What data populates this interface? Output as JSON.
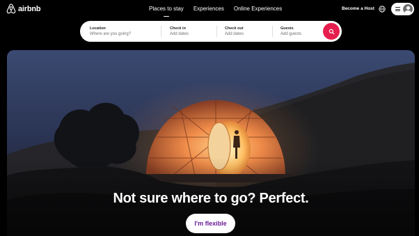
{
  "header": {
    "logo_text": "airbnb",
    "nav": [
      {
        "label": "Places to stay",
        "active": true
      },
      {
        "label": "Experiences",
        "active": false
      },
      {
        "label": "Online Experiences",
        "active": false
      }
    ],
    "become_host": "Become a Host",
    "icons": {
      "logo": "airbnb-logo-icon",
      "globe": "globe-icon",
      "menu": "hamburger-menu-icon",
      "avatar": "user-avatar-icon"
    }
  },
  "search": {
    "location": {
      "label": "Location",
      "placeholder": "Where are you going?"
    },
    "check_in": {
      "label": "Check in",
      "placeholder": "Add dates"
    },
    "check_out": {
      "label": "Check out",
      "placeholder": "Add dates"
    },
    "guests": {
      "label": "Guests",
      "placeholder": "Add guests"
    },
    "button_icon": "search-icon",
    "accent_color": "#e61e4d"
  },
  "hero": {
    "headline": "Not sure where to go? Perfect.",
    "cta_label": "I'm flexible",
    "cta_color": "#6a1b9a"
  }
}
